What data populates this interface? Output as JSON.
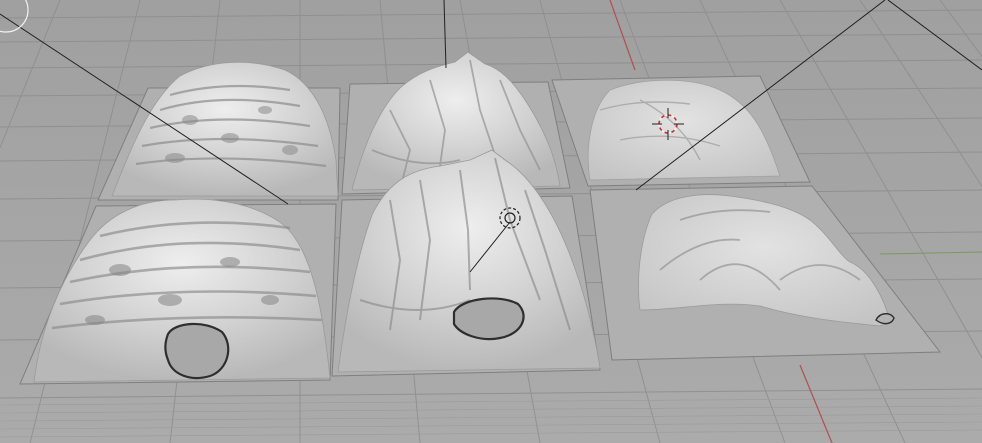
{
  "viewport": {
    "view": "perspective",
    "shading": "solid",
    "colors": {
      "background": "#a6a6a6",
      "grid_line": "#8e8e8e",
      "x_axis": "#b05050",
      "y_axis": "#7a9a5a",
      "terrain_base": "#d4d4d4",
      "terrain_shadow": "#8c8c8c",
      "terrain_highlight": "#ececec",
      "hole": "#2e2e2e",
      "cursor_red": "#c83030",
      "cursor_white": "#f0f0f0",
      "relationship_line": "#202020"
    },
    "icons": [
      "navigation-gizmo-icon",
      "3d-cursor-icon",
      "light-object-icon"
    ],
    "objects": [
      {
        "name": "terrain-ridged-top-left",
        "has_hole": false
      },
      {
        "name": "terrain-peaks-top-center",
        "has_hole": false
      },
      {
        "name": "terrain-flat-top-right",
        "has_hole": false
      },
      {
        "name": "terrain-ridged-bottom-left",
        "has_hole": true
      },
      {
        "name": "terrain-peaks-bottom-center",
        "has_hole": true
      },
      {
        "name": "terrain-hills-bottom-right",
        "has_hole": false
      }
    ]
  }
}
